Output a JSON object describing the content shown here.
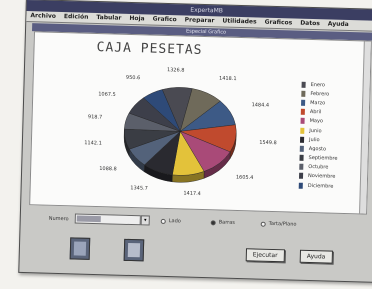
{
  "window": {
    "title": "ExpertaMB",
    "subtitle": "Especial Grafico"
  },
  "menu": [
    "Archivo",
    "Edición",
    "Tabular",
    "Hoja",
    "Grafico",
    "Preparar",
    "Utilidades",
    "Graficos",
    "Datos",
    "Ayuda"
  ],
  "chart_data": {
    "type": "pie",
    "title": "CAJA PESETAS",
    "categories": [
      "Enero",
      "Febrero",
      "Marzo",
      "Abril",
      "Mayo",
      "Junio",
      "Julio",
      "Agosto",
      "Septiembre",
      "Octubre",
      "Noviembre",
      "Diciembre"
    ],
    "values": [
      1326.8,
      1418.1,
      1484.4,
      1549.8,
      1605.4,
      1417.4,
      1345.7,
      1088.8,
      1142.1,
      918.7,
      1067.5,
      950.6
    ],
    "value_labels": [
      "1326.8",
      "1418.1",
      "1484.4",
      "1549.8",
      "1605.4",
      "1417.4",
      "1345.7",
      "1088.8",
      "1142.1",
      "918.7",
      "1067.5",
      "950.6"
    ],
    "colors": [
      "#4a4a52",
      "#6f6a5a",
      "#3d5a86",
      "#c04a2e",
      "#a94a78",
      "#e3c23a",
      "#2a2a30",
      "#53627a",
      "#3a3d44",
      "#5b5f6a",
      "#3d3f4a",
      "#2e4a78"
    ],
    "legend_position": "right"
  },
  "controls": {
    "numero_label": "Numero",
    "radio_options": [
      {
        "label": "Lado",
        "selected": false
      },
      {
        "label": "Barras",
        "selected": true
      },
      {
        "label": "Tarta/Plano",
        "selected": false
      }
    ],
    "buttons": {
      "execute": "Ejecutar",
      "help": "Ayuda"
    }
  },
  "icons": {
    "chart_icon": "chart-icon",
    "document_icon": "document-icon",
    "dropdown": "▾",
    "scroll_up": "▴",
    "scroll_down": "▾"
  }
}
